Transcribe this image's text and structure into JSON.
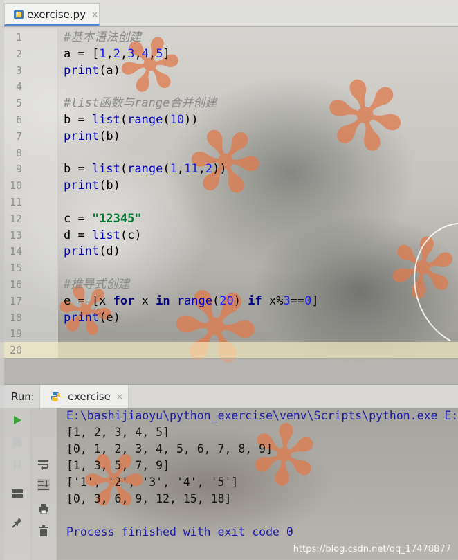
{
  "editor_tab": {
    "filename": "exercise.py",
    "close": "×"
  },
  "code_lines": [
    {
      "n": "1",
      "tokens": [
        {
          "t": "#基本语法创建",
          "c": "t-cmt"
        }
      ]
    },
    {
      "n": "2",
      "tokens": [
        {
          "t": "a = ["
        },
        {
          "t": "1",
          "c": "t-num"
        },
        {
          "t": ","
        },
        {
          "t": "2",
          "c": "t-num"
        },
        {
          "t": ","
        },
        {
          "t": "3",
          "c": "t-num"
        },
        {
          "t": ","
        },
        {
          "t": "4",
          "c": "t-num"
        },
        {
          "t": ","
        },
        {
          "t": "5",
          "c": "t-num"
        },
        {
          "t": "]"
        }
      ]
    },
    {
      "n": "3",
      "tokens": [
        {
          "t": "print",
          "c": "t-builtin"
        },
        {
          "t": "(a)"
        }
      ]
    },
    {
      "n": "4",
      "tokens": []
    },
    {
      "n": "5",
      "tokens": [
        {
          "t": "#list函数与range合并创建",
          "c": "t-cmt"
        }
      ]
    },
    {
      "n": "6",
      "tokens": [
        {
          "t": "b = "
        },
        {
          "t": "list",
          "c": "t-builtin"
        },
        {
          "t": "("
        },
        {
          "t": "range",
          "c": "t-builtin"
        },
        {
          "t": "("
        },
        {
          "t": "10",
          "c": "t-num"
        },
        {
          "t": "))"
        }
      ]
    },
    {
      "n": "7",
      "tokens": [
        {
          "t": "print",
          "c": "t-builtin"
        },
        {
          "t": "(b)"
        }
      ]
    },
    {
      "n": "8",
      "tokens": []
    },
    {
      "n": "9",
      "tokens": [
        {
          "t": "b = "
        },
        {
          "t": "list",
          "c": "t-builtin"
        },
        {
          "t": "("
        },
        {
          "t": "range",
          "c": "t-builtin"
        },
        {
          "t": "("
        },
        {
          "t": "1",
          "c": "t-num"
        },
        {
          "t": ","
        },
        {
          "t": "11",
          "c": "t-num"
        },
        {
          "t": ","
        },
        {
          "t": "2",
          "c": "t-num"
        },
        {
          "t": "))"
        }
      ]
    },
    {
      "n": "10",
      "tokens": [
        {
          "t": "print",
          "c": "t-builtin"
        },
        {
          "t": "(b)"
        }
      ]
    },
    {
      "n": "11",
      "tokens": []
    },
    {
      "n": "12",
      "tokens": [
        {
          "t": "c = "
        },
        {
          "t": "\"12345\"",
          "c": "t-str"
        }
      ]
    },
    {
      "n": "13",
      "tokens": [
        {
          "t": "d = "
        },
        {
          "t": "list",
          "c": "t-builtin"
        },
        {
          "t": "(c)"
        }
      ]
    },
    {
      "n": "14",
      "tokens": [
        {
          "t": "print",
          "c": "t-builtin"
        },
        {
          "t": "(d)"
        }
      ]
    },
    {
      "n": "15",
      "tokens": []
    },
    {
      "n": "16",
      "tokens": [
        {
          "t": "#推导式创建",
          "c": "t-cmt"
        }
      ]
    },
    {
      "n": "17",
      "tokens": [
        {
          "t": "e = [x "
        },
        {
          "t": "for",
          "c": "t-kw"
        },
        {
          "t": " x "
        },
        {
          "t": "in",
          "c": "t-kw"
        },
        {
          "t": " "
        },
        {
          "t": "range",
          "c": "t-builtin"
        },
        {
          "t": "("
        },
        {
          "t": "20",
          "c": "t-num"
        },
        {
          "t": ") "
        },
        {
          "t": "if",
          "c": "t-kw"
        },
        {
          "t": " x%"
        },
        {
          "t": "3",
          "c": "t-num"
        },
        {
          "t": "=="
        },
        {
          "t": "0",
          "c": "t-num"
        },
        {
          "t": "]"
        }
      ]
    },
    {
      "n": "18",
      "tokens": [
        {
          "t": "print",
          "c": "t-builtin"
        },
        {
          "t": "(e)"
        }
      ]
    },
    {
      "n": "19",
      "tokens": []
    },
    {
      "n": "20",
      "tokens": [],
      "current": true
    }
  ],
  "run_panel": {
    "label": "Run:",
    "tab_name": "exercise",
    "close": "×"
  },
  "console_lines": [
    {
      "text": "E:\\bashijiaoyu\\python_exercise\\venv\\Scripts\\python.exe E:",
      "c": "c-path"
    },
    {
      "text": "[1, 2, 3, 4, 5]"
    },
    {
      "text": "[0, 1, 2, 3, 4, 5, 6, 7, 8, 9]"
    },
    {
      "text": "[1, 3, 5, 7, 9]"
    },
    {
      "text": "['1', '2', '3', '4', '5']"
    },
    {
      "text": "[0, 3, 6, 9, 12, 15, 18]"
    },
    {
      "text": ""
    },
    {
      "text": "Process finished with exit code 0",
      "c": "c-exit"
    }
  ],
  "watermark": "https://blog.csdn.net/qq_17478877",
  "colors": {
    "accent": "#4a86c8",
    "run_green": "#3aa33a"
  }
}
